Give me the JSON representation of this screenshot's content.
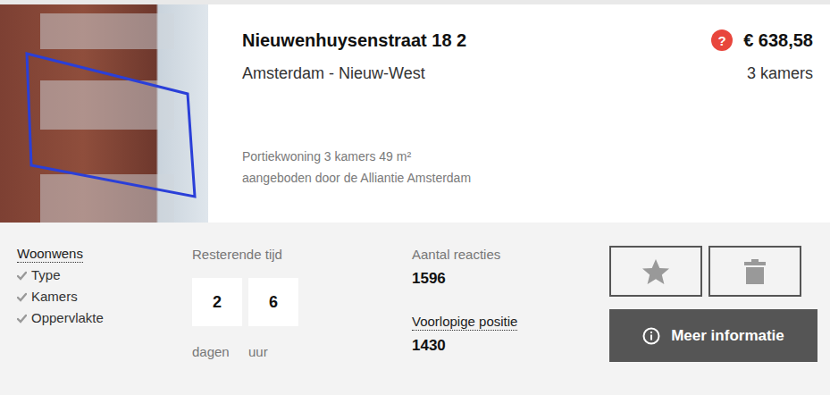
{
  "listing": {
    "address": "Nieuwenhuysenstraat 18 2",
    "price_badge": "?",
    "price": "€ 638,58",
    "location": "Amsterdam - Nieuw-West",
    "rooms": "3 kamers",
    "description": "Portiekwoning 3 kamers 49 m²",
    "offered_by": "aangeboden door de Alliantie Amsterdam"
  },
  "woonwens": {
    "label": "Woonwens",
    "items": [
      {
        "label": "Type",
        "checked": true
      },
      {
        "label": "Kamers",
        "checked": true
      },
      {
        "label": "Oppervlakte",
        "checked": true
      }
    ]
  },
  "remaining": {
    "label": "Resterende tijd",
    "units": [
      {
        "value": "2",
        "unit": "dagen"
      },
      {
        "value": "6",
        "unit": "uur"
      }
    ]
  },
  "reactions": {
    "label": "Aantal reacties",
    "value": "1596"
  },
  "position": {
    "label": "Voorlopige positie",
    "value": "1430"
  },
  "actions": {
    "more_info": "Meer informatie"
  }
}
